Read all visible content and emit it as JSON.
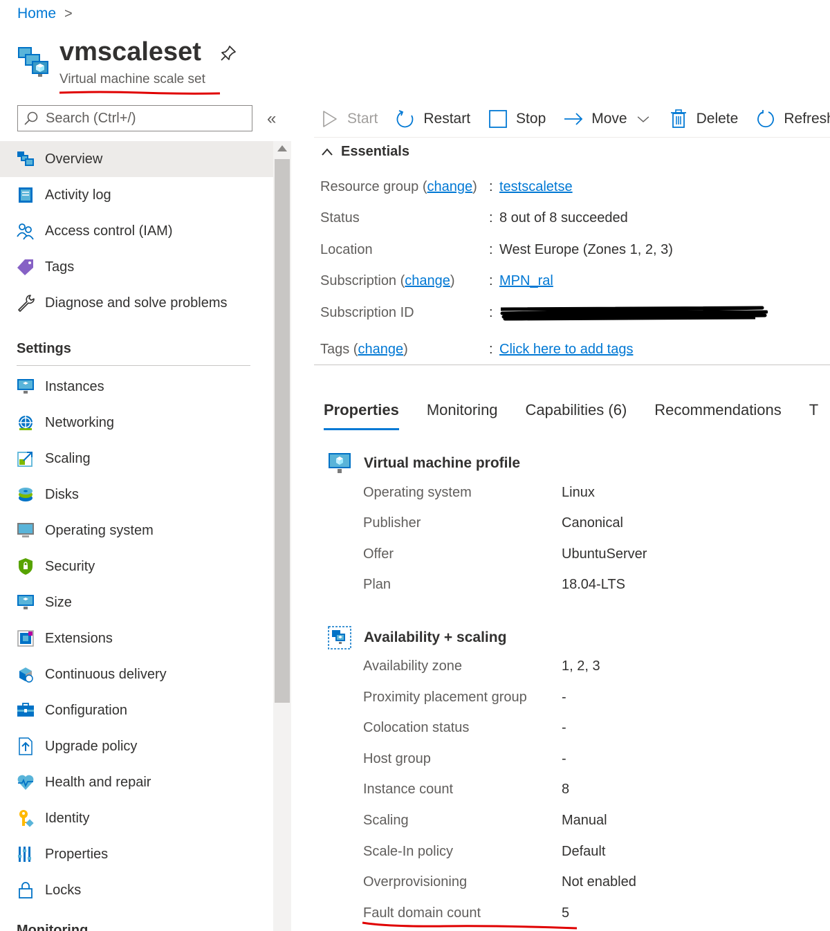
{
  "breadcrumb": {
    "home": "Home",
    "separator": ">"
  },
  "header": {
    "title": "vmscaleset",
    "subtitle": "Virtual machine scale set",
    "pin_icon": "pin-icon",
    "resource_icon": "vm-scale-set-icon"
  },
  "search": {
    "placeholder": "Search (Ctrl+/)"
  },
  "collapse": {
    "label": "«"
  },
  "sidebar": {
    "items": [
      {
        "label": "Overview",
        "icon": "overview-icon",
        "active": true
      },
      {
        "label": "Activity log",
        "icon": "activity-log-icon"
      },
      {
        "label": "Access control (IAM)",
        "icon": "iam-icon"
      },
      {
        "label": "Tags",
        "icon": "tag-icon"
      },
      {
        "label": "Diagnose and solve problems",
        "icon": "wrench-icon"
      }
    ],
    "settings_title": "Settings",
    "settings_items": [
      {
        "label": "Instances",
        "icon": "monitor-icon"
      },
      {
        "label": "Networking",
        "icon": "network-icon"
      },
      {
        "label": "Scaling",
        "icon": "scaling-icon"
      },
      {
        "label": "Disks",
        "icon": "disk-icon"
      },
      {
        "label": "Operating system",
        "icon": "os-icon"
      },
      {
        "label": "Security",
        "icon": "shield-icon"
      },
      {
        "label": "Size",
        "icon": "size-icon"
      },
      {
        "label": "Extensions",
        "icon": "extensions-icon"
      },
      {
        "label": "Continuous delivery",
        "icon": "continuous-delivery-icon"
      },
      {
        "label": "Configuration",
        "icon": "configuration-icon"
      },
      {
        "label": "Upgrade policy",
        "icon": "upgrade-icon"
      },
      {
        "label": "Health and repair",
        "icon": "health-icon"
      },
      {
        "label": "Identity",
        "icon": "key-icon"
      },
      {
        "label": "Properties",
        "icon": "properties-icon"
      },
      {
        "label": "Locks",
        "icon": "lock-icon"
      }
    ],
    "monitoring_title": "Monitoring"
  },
  "toolbar": {
    "start": "Start",
    "restart": "Restart",
    "stop": "Stop",
    "move": "Move",
    "delete": "Delete",
    "refresh": "Refresh"
  },
  "essentials": {
    "title": "Essentials",
    "change": "change",
    "resource_group_label": "Resource group",
    "resource_group_value": "testscaletse",
    "status_label": "Status",
    "status_value": "8 out of 8 succeeded",
    "location_label": "Location",
    "location_value": "West Europe (Zones 1, 2, 3)",
    "subscription_label": "Subscription",
    "subscription_value": "MPN_ral",
    "subscription_id_label": "Subscription ID",
    "tags_label": "Tags",
    "tags_value": "Click here to add tags",
    "colon": ":"
  },
  "tabs": [
    "Properties",
    "Monitoring",
    "Capabilities (6)",
    "Recommendations",
    "T"
  ],
  "vm_profile": {
    "title": "Virtual machine profile",
    "rows": [
      {
        "label": "Operating system",
        "value": "Linux"
      },
      {
        "label": "Publisher",
        "value": "Canonical"
      },
      {
        "label": "Offer",
        "value": "UbuntuServer"
      },
      {
        "label": "Plan",
        "value": "18.04-LTS"
      }
    ]
  },
  "availability": {
    "title": "Availability + scaling",
    "rows": [
      {
        "label": "Availability zone",
        "value": "1, 2, 3"
      },
      {
        "label": "Proximity placement group",
        "value": "-"
      },
      {
        "label": "Colocation status",
        "value": "-"
      },
      {
        "label": "Host group",
        "value": "-"
      },
      {
        "label": "Instance count",
        "value": "8"
      },
      {
        "label": "Scaling",
        "value": "Manual"
      },
      {
        "label": "Scale-In policy",
        "value": "Default"
      },
      {
        "label": "Overprovisioning",
        "value": "Not enabled"
      },
      {
        "label": "Fault domain count",
        "value": "5"
      }
    ]
  },
  "colors": {
    "accent": "#0078d4",
    "annotation_red": "#e00000"
  }
}
